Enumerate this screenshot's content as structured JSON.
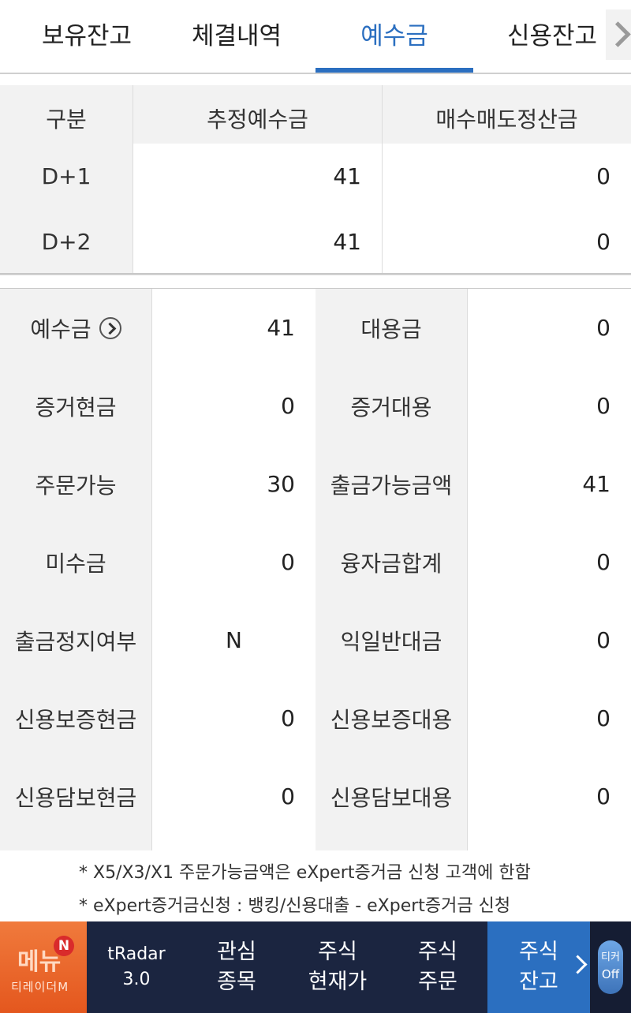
{
  "tabs": [
    {
      "label": "보유잔고"
    },
    {
      "label": "체결내역"
    },
    {
      "label": "예수금"
    },
    {
      "label": "신용잔고"
    }
  ],
  "summary_table": {
    "headers": [
      "구분",
      "추정예수금",
      "매수매도정산금"
    ],
    "rows": [
      {
        "label": "D+1",
        "estimated": "41",
        "settlement": "0"
      },
      {
        "label": "D+2",
        "estimated": "41",
        "settlement": "0"
      }
    ]
  },
  "detail_table": {
    "rows": [
      {
        "l1": "예수금",
        "v1": "41",
        "l2": "대용금",
        "v2": "0"
      },
      {
        "l1": "증거현금",
        "v1": "0",
        "l2": "증거대용",
        "v2": "0"
      },
      {
        "l1": "주문가능",
        "v1": "30",
        "l2": "출금가능금액",
        "v2": "41"
      },
      {
        "l1": "미수금",
        "v1": "0",
        "l2": "융자금합계",
        "v2": "0"
      },
      {
        "l1": "출금정지여부",
        "v1": "N",
        "l2": "익일반대금",
        "v2": "0"
      },
      {
        "l1": "신용보증현금",
        "v1": "0",
        "l2": "신용보증대용",
        "v2": "0"
      },
      {
        "l1": "신용담보현금",
        "v1": "0",
        "l2": "신용담보대용",
        "v2": "0"
      }
    ]
  },
  "notes": [
    "* X5/X3/X1 주문가능금액은 eXpert증거금 신청 고객에 한함",
    "* eXpert증거금신청 : 뱅킹/신용대출 - eXpert증거금 신청"
  ],
  "bottom_nav": {
    "menu_label": "메뉴",
    "menu_badge": "N",
    "menu_brand": "티레이더M",
    "items": [
      {
        "line1": "tRadar",
        "line2": "3.0"
      },
      {
        "line1": "관심",
        "line2": "종목"
      },
      {
        "line1": "주식",
        "line2": "현재가"
      },
      {
        "line1": "주식",
        "line2": "주문"
      },
      {
        "line1": "주식",
        "line2": "잔고"
      }
    ],
    "ticker_label": "티커",
    "ticker_state": "Off"
  },
  "colors": {
    "accent": "#2b6fc0",
    "nav_bg": "#1b2540",
    "menu_orange": "#e4571e"
  }
}
